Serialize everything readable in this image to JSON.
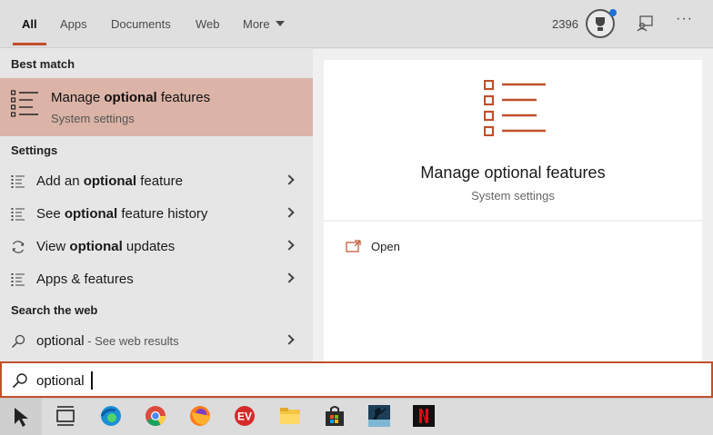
{
  "tabs": [
    {
      "label": "All",
      "active": true
    },
    {
      "label": "Apps"
    },
    {
      "label": "Documents"
    },
    {
      "label": "Web"
    },
    {
      "label": "More"
    }
  ],
  "header": {
    "points": "2396"
  },
  "left": {
    "best_match_heading": "Best match",
    "best_match": {
      "title_pre": "Manage ",
      "title_bold": "optional",
      "title_post": " features",
      "subtitle": "System settings"
    },
    "settings_heading": "Settings",
    "settings": [
      {
        "pre": "Add an ",
        "bold": "optional",
        "post": " feature",
        "icon": "list-icon"
      },
      {
        "pre": "See ",
        "bold": "optional",
        "post": " feature history",
        "icon": "list-icon"
      },
      {
        "pre": "View ",
        "bold": "optional",
        "post": " updates",
        "icon": "refresh-icon"
      },
      {
        "pre": "Apps & features",
        "bold": "",
        "post": "",
        "icon": "list-icon"
      }
    ],
    "web_heading": "Search the web",
    "web": {
      "query": "optional",
      "hint": " - See web results"
    }
  },
  "detail": {
    "title": "Manage optional features",
    "subtitle": "System settings",
    "open_label": "Open"
  },
  "search": {
    "value": "optional"
  },
  "taskbar": [
    "start-icon",
    "task-view-icon",
    "edge-icon",
    "chrome-icon",
    "firefox-icon",
    "expressvpn-icon",
    "file-explorer-icon",
    "store-icon",
    "kindle-icon",
    "netflix-icon"
  ],
  "colors": {
    "accent": "#c0502a",
    "highlight": "#dbb3a7"
  }
}
